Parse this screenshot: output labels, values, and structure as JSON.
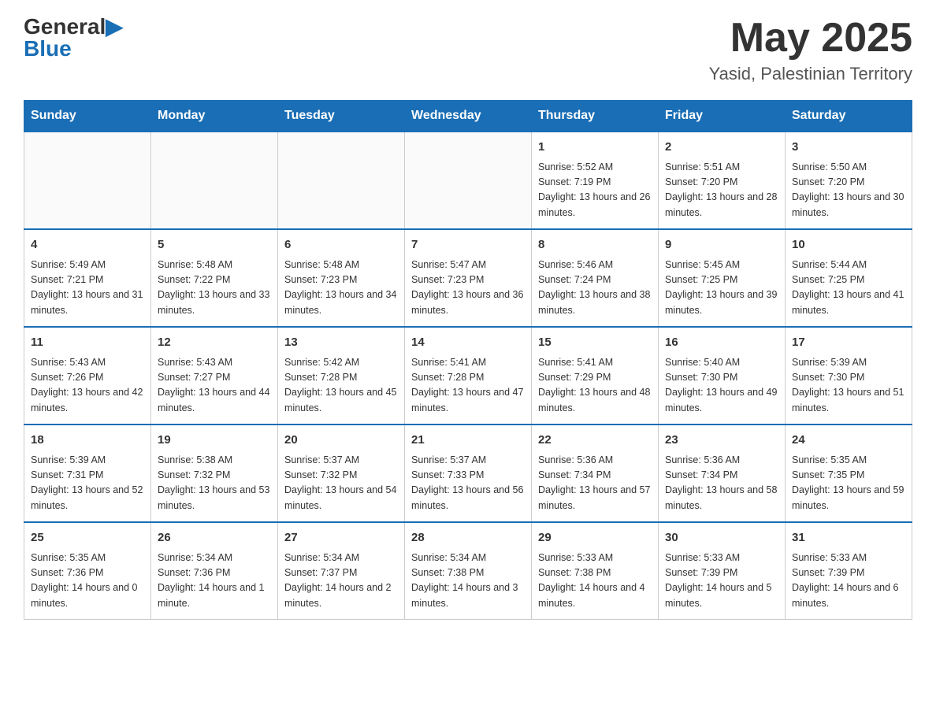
{
  "header": {
    "logo_general": "General",
    "logo_blue": "Blue",
    "month_title": "May 2025",
    "location": "Yasid, Palestinian Territory"
  },
  "calendar": {
    "days_of_week": [
      "Sunday",
      "Monday",
      "Tuesday",
      "Wednesday",
      "Thursday",
      "Friday",
      "Saturday"
    ],
    "weeks": [
      {
        "days": [
          {
            "number": "",
            "info": ""
          },
          {
            "number": "",
            "info": ""
          },
          {
            "number": "",
            "info": ""
          },
          {
            "number": "",
            "info": ""
          },
          {
            "number": "1",
            "info": "Sunrise: 5:52 AM\nSunset: 7:19 PM\nDaylight: 13 hours and 26 minutes."
          },
          {
            "number": "2",
            "info": "Sunrise: 5:51 AM\nSunset: 7:20 PM\nDaylight: 13 hours and 28 minutes."
          },
          {
            "number": "3",
            "info": "Sunrise: 5:50 AM\nSunset: 7:20 PM\nDaylight: 13 hours and 30 minutes."
          }
        ]
      },
      {
        "days": [
          {
            "number": "4",
            "info": "Sunrise: 5:49 AM\nSunset: 7:21 PM\nDaylight: 13 hours and 31 minutes."
          },
          {
            "number": "5",
            "info": "Sunrise: 5:48 AM\nSunset: 7:22 PM\nDaylight: 13 hours and 33 minutes."
          },
          {
            "number": "6",
            "info": "Sunrise: 5:48 AM\nSunset: 7:23 PM\nDaylight: 13 hours and 34 minutes."
          },
          {
            "number": "7",
            "info": "Sunrise: 5:47 AM\nSunset: 7:23 PM\nDaylight: 13 hours and 36 minutes."
          },
          {
            "number": "8",
            "info": "Sunrise: 5:46 AM\nSunset: 7:24 PM\nDaylight: 13 hours and 38 minutes."
          },
          {
            "number": "9",
            "info": "Sunrise: 5:45 AM\nSunset: 7:25 PM\nDaylight: 13 hours and 39 minutes."
          },
          {
            "number": "10",
            "info": "Sunrise: 5:44 AM\nSunset: 7:25 PM\nDaylight: 13 hours and 41 minutes."
          }
        ]
      },
      {
        "days": [
          {
            "number": "11",
            "info": "Sunrise: 5:43 AM\nSunset: 7:26 PM\nDaylight: 13 hours and 42 minutes."
          },
          {
            "number": "12",
            "info": "Sunrise: 5:43 AM\nSunset: 7:27 PM\nDaylight: 13 hours and 44 minutes."
          },
          {
            "number": "13",
            "info": "Sunrise: 5:42 AM\nSunset: 7:28 PM\nDaylight: 13 hours and 45 minutes."
          },
          {
            "number": "14",
            "info": "Sunrise: 5:41 AM\nSunset: 7:28 PM\nDaylight: 13 hours and 47 minutes."
          },
          {
            "number": "15",
            "info": "Sunrise: 5:41 AM\nSunset: 7:29 PM\nDaylight: 13 hours and 48 minutes."
          },
          {
            "number": "16",
            "info": "Sunrise: 5:40 AM\nSunset: 7:30 PM\nDaylight: 13 hours and 49 minutes."
          },
          {
            "number": "17",
            "info": "Sunrise: 5:39 AM\nSunset: 7:30 PM\nDaylight: 13 hours and 51 minutes."
          }
        ]
      },
      {
        "days": [
          {
            "number": "18",
            "info": "Sunrise: 5:39 AM\nSunset: 7:31 PM\nDaylight: 13 hours and 52 minutes."
          },
          {
            "number": "19",
            "info": "Sunrise: 5:38 AM\nSunset: 7:32 PM\nDaylight: 13 hours and 53 minutes."
          },
          {
            "number": "20",
            "info": "Sunrise: 5:37 AM\nSunset: 7:32 PM\nDaylight: 13 hours and 54 minutes."
          },
          {
            "number": "21",
            "info": "Sunrise: 5:37 AM\nSunset: 7:33 PM\nDaylight: 13 hours and 56 minutes."
          },
          {
            "number": "22",
            "info": "Sunrise: 5:36 AM\nSunset: 7:34 PM\nDaylight: 13 hours and 57 minutes."
          },
          {
            "number": "23",
            "info": "Sunrise: 5:36 AM\nSunset: 7:34 PM\nDaylight: 13 hours and 58 minutes."
          },
          {
            "number": "24",
            "info": "Sunrise: 5:35 AM\nSunset: 7:35 PM\nDaylight: 13 hours and 59 minutes."
          }
        ]
      },
      {
        "days": [
          {
            "number": "25",
            "info": "Sunrise: 5:35 AM\nSunset: 7:36 PM\nDaylight: 14 hours and 0 minutes."
          },
          {
            "number": "26",
            "info": "Sunrise: 5:34 AM\nSunset: 7:36 PM\nDaylight: 14 hours and 1 minute."
          },
          {
            "number": "27",
            "info": "Sunrise: 5:34 AM\nSunset: 7:37 PM\nDaylight: 14 hours and 2 minutes."
          },
          {
            "number": "28",
            "info": "Sunrise: 5:34 AM\nSunset: 7:38 PM\nDaylight: 14 hours and 3 minutes."
          },
          {
            "number": "29",
            "info": "Sunrise: 5:33 AM\nSunset: 7:38 PM\nDaylight: 14 hours and 4 minutes."
          },
          {
            "number": "30",
            "info": "Sunrise: 5:33 AM\nSunset: 7:39 PM\nDaylight: 14 hours and 5 minutes."
          },
          {
            "number": "31",
            "info": "Sunrise: 5:33 AM\nSunset: 7:39 PM\nDaylight: 14 hours and 6 minutes."
          }
        ]
      }
    ]
  }
}
